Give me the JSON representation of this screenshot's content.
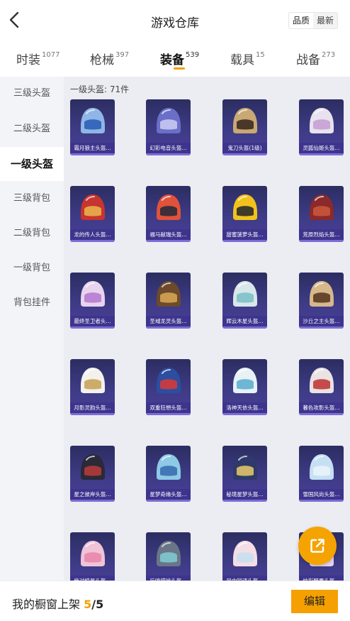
{
  "header": {
    "title": "游戏仓库",
    "back_icon": "chevron-left-icon",
    "sort_options": [
      "品质",
      "最新"
    ],
    "sort_selected": "品质"
  },
  "tabs": [
    {
      "label": "时装",
      "count": "1077",
      "active": false
    },
    {
      "label": "枪械",
      "count": "397",
      "active": false
    },
    {
      "label": "装备",
      "count": "539",
      "active": true
    },
    {
      "label": "载具",
      "count": "15",
      "active": false
    },
    {
      "label": "战备",
      "count": "273",
      "active": false
    }
  ],
  "sidebar": {
    "items": [
      "三级头盔",
      "二级头盔",
      "一级头盔",
      "三级背包",
      "二级背包",
      "一级背包",
      "背包挂件"
    ],
    "active": "一级头盔"
  },
  "main": {
    "count_label": "一级头盔: 71件",
    "items": [
      {
        "name": "霜月狼主头盔...",
        "color": "#8fb6e6",
        "accent": "#2c5fb8"
      },
      {
        "name": "幻彩电音头盔...",
        "color": "#6a6fc7",
        "accent": "#c8c8f0"
      },
      {
        "name": "鬼刀头盔(1级)",
        "color": "#c9a874",
        "accent": "#3b2a22"
      },
      {
        "name": "灵狐仙姬头盔...",
        "color": "#e8e2ef",
        "accent": "#c7a1d3"
      },
      {
        "name": "龙的传人头盔...",
        "color": "#c8342f",
        "accent": "#e7b04a"
      },
      {
        "name": "福马献瑞头盔...",
        "color": "#e0523a",
        "accent": "#2b2b3a"
      },
      {
        "name": "甜蜜菠萝头盔...",
        "color": "#f2c21b",
        "accent": "#2b2b2b"
      },
      {
        "name": "荒原烈焰头盔...",
        "color": "#8a2a2a",
        "accent": "#c9553c"
      },
      {
        "name": "最终圣卫者头...",
        "color": "#e8d4ee",
        "accent": "#b77bd0"
      },
      {
        "name": "圣域龙灵头盔...",
        "color": "#6d4a2b",
        "accent": "#d3a354"
      },
      {
        "name": "辉云木星头盔...",
        "color": "#d8e7ea",
        "accent": "#7fc0c9"
      },
      {
        "name": "沙丘之主头盔...",
        "color": "#d6b88a",
        "accent": "#5a3a22"
      },
      {
        "name": "月影灵韵头盔...",
        "color": "#f3f1ee",
        "accent": "#c9a45b"
      },
      {
        "name": "双重狂想头盔...",
        "color": "#2b4ea1",
        "accent": "#d43a3a"
      },
      {
        "name": "洛神天依头盔...",
        "color": "#e7f1f6",
        "accent": "#5fb0d0"
      },
      {
        "name": "暮色攻影头盔...",
        "color": "#e9e3e3",
        "accent": "#c13a3a"
      },
      {
        "name": "星之彼岸头盔...",
        "color": "#2a2a38",
        "accent": "#b23a3a"
      },
      {
        "name": "星梦奇缘头盔...",
        "color": "#8ec9e6",
        "accent": "#3a6fb0"
      },
      {
        "name": "秘境星梦头盔...",
        "color": "#2f3a6a",
        "accent": "#e0c36a"
      },
      {
        "name": "雪国风尚头盔...",
        "color": "#c5e0f2",
        "accent": "#e9f3fa"
      },
      {
        "name": "绝对惊星头盔...",
        "color": "#f0c3d6",
        "accent": "#e987ad"
      },
      {
        "name": "后嗅喵哈头盔...",
        "color": "#6a7687",
        "accent": "#7fc9d0"
      },
      {
        "name": "风中短语头盔...",
        "color": "#f4dde4",
        "accent": "#c6e0ef"
      },
      {
        "name": "炫彩糖果头盔...",
        "color": "#e7d6ee",
        "accent": "#f0b3c6"
      }
    ]
  },
  "fab": {
    "icon": "share-external-icon"
  },
  "footer": {
    "label": "我的橱窗上架",
    "current": "5",
    "separator": "/",
    "total": "5",
    "edit_label": "编辑"
  }
}
